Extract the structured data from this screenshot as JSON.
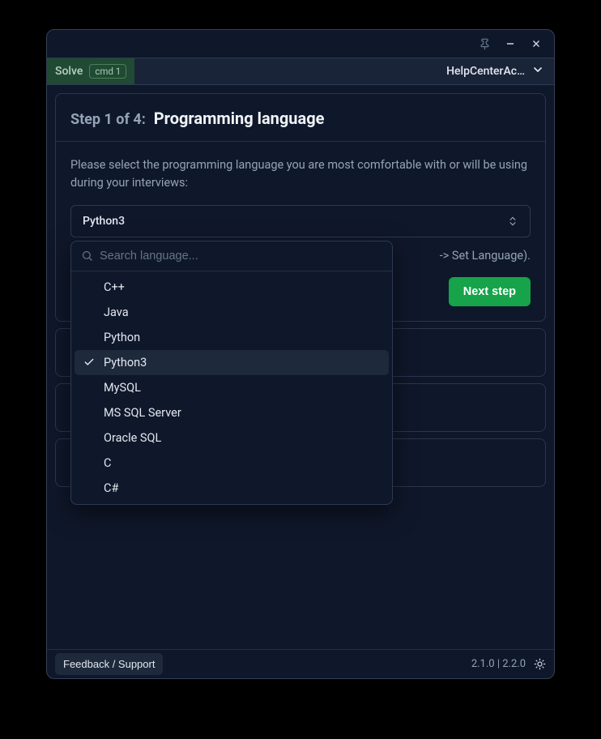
{
  "titlebar": {},
  "topbar": {
    "solve_label": "Solve",
    "keycap": "cmd 1",
    "help_label": "HelpCenterAc…"
  },
  "step": {
    "number_label": "Step 1 of 4:",
    "title": "Programming language",
    "instructions": "Please select the programming language you are most comfortable with or will be using during your interviews:",
    "selected_value": "Python3",
    "hint_suffix": "-> Set Language).",
    "next_label": "Next step"
  },
  "dropdown": {
    "search_placeholder": "Search language...",
    "options": [
      {
        "label": "C++",
        "selected": false
      },
      {
        "label": "Java",
        "selected": false
      },
      {
        "label": "Python",
        "selected": false
      },
      {
        "label": "Python3",
        "selected": true
      },
      {
        "label": "MySQL",
        "selected": false
      },
      {
        "label": "MS SQL Server",
        "selected": false
      },
      {
        "label": "Oracle SQL",
        "selected": false
      },
      {
        "label": "C",
        "selected": false
      },
      {
        "label": "C#",
        "selected": false
      }
    ]
  },
  "footer": {
    "feedback_label": "Feedback / Support",
    "version": "2.1.0 | 2.2.0"
  }
}
